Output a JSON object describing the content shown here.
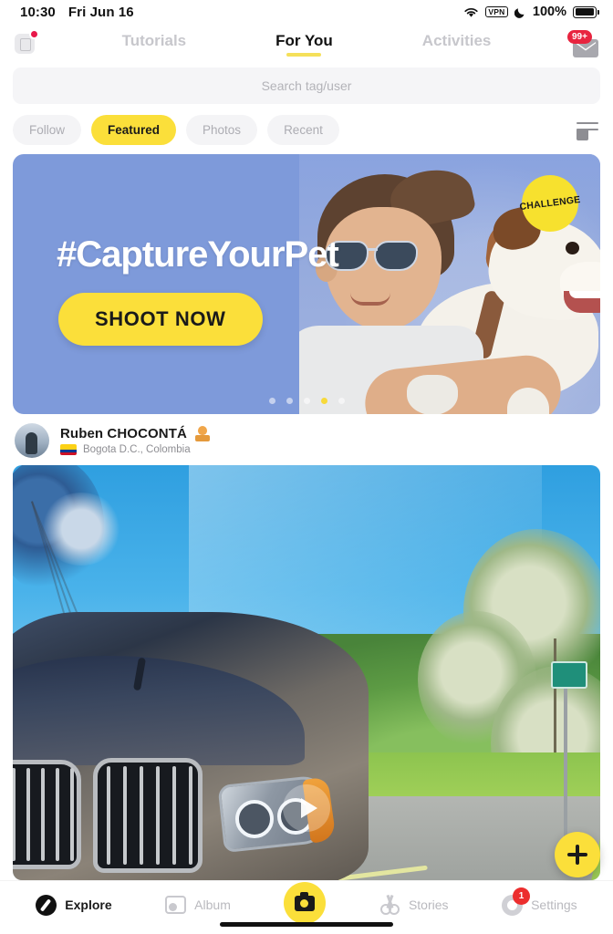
{
  "status_bar": {
    "time": "10:30",
    "date": "Fri Jun 16",
    "wifi_icon": "wifi-icon",
    "vpn_label": "VPN",
    "dnd_icon": "moon-icon",
    "battery_percent": "100%",
    "battery_icon": "battery-full-icon"
  },
  "top_nav": {
    "left_icon": "app-badge-icon",
    "tabs": [
      {
        "label": "Tutorials",
        "active": false
      },
      {
        "label": "For You",
        "active": true
      },
      {
        "label": "Activities",
        "active": false
      }
    ],
    "mail_icon": "mail-icon",
    "mail_badge": "99+"
  },
  "search": {
    "placeholder": "Search tag/user",
    "value": ""
  },
  "chips": {
    "items": [
      {
        "label": "Follow",
        "active": false
      },
      {
        "label": "Featured",
        "active": true
      },
      {
        "label": "Photos",
        "active": false
      },
      {
        "label": "Recent",
        "active": false
      }
    ],
    "filter_icon": "filter-add-icon"
  },
  "hero": {
    "hashtag": "#CaptureYourPet",
    "cta_label": "SHOOT NOW",
    "badge_label": "CHALLENGE",
    "carousel": {
      "count": 5,
      "active_index": 3
    },
    "image_alt": "boy-with-dog-photo"
  },
  "post": {
    "author": "Ruben CHOCONTÁ",
    "rank_icon": "rank-badge-icon",
    "location": "Bogota D.C., Colombia",
    "flag_icon": "colombia-flag-icon",
    "avatar_icon": "user-avatar",
    "media_type": "video",
    "play_icon": "play-icon",
    "image_alt": "car-on-country-road-photo"
  },
  "fab": {
    "icon": "plus-icon"
  },
  "bottom_nav": {
    "items": [
      {
        "label": "Explore",
        "icon": "compass-icon",
        "active": true,
        "badge": ""
      },
      {
        "label": "Album",
        "icon": "album-icon",
        "active": false,
        "badge": ""
      },
      {
        "label": "Stories",
        "icon": "scissors-icon",
        "active": false,
        "badge": ""
      },
      {
        "label": "Settings",
        "icon": "gear-icon",
        "active": false,
        "badge": "1"
      }
    ],
    "center_button_icon": "camera-icon"
  },
  "colors": {
    "accent_yellow": "#fbdf3a",
    "badge_red": "#e8243f",
    "hero_blue": "#7e9ada",
    "muted_gray": "#b9b9be"
  }
}
